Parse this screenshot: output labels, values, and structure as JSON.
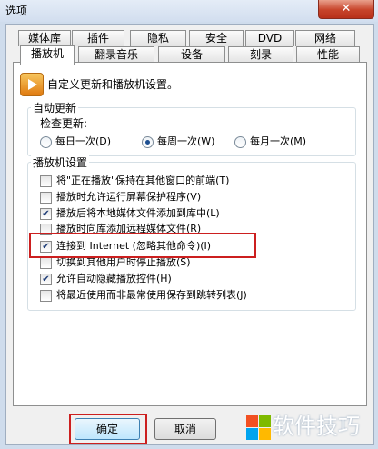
{
  "window": {
    "title": "选项",
    "close_glyph": "✕"
  },
  "tabs": {
    "back_row": [
      "媒体库",
      "插件",
      "隐私",
      "安全",
      "DVD",
      "网络"
    ],
    "front_row": [
      "播放机",
      "翻录音乐",
      "设备",
      "刻录",
      "性能"
    ],
    "active": "播放机"
  },
  "header": {
    "icon": "player-icon",
    "description": "自定义更新和播放机设置。"
  },
  "auto_update": {
    "title": "自动更新",
    "check_label": "检查更新:",
    "options": [
      {
        "label": "每日一次(D)",
        "selected": false
      },
      {
        "label": "每周一次(W)",
        "selected": true
      },
      {
        "label": "每月一次(M)",
        "selected": false
      }
    ]
  },
  "player_settings": {
    "title": "播放机设置",
    "options": [
      {
        "label": "将\"正在播放\"保持在其他窗口的前端(T)",
        "checked": false
      },
      {
        "label": "播放时允许运行屏幕保护程序(V)",
        "checked": false
      },
      {
        "label": "播放后将本地媒体文件添加到库中(L)",
        "checked": true
      },
      {
        "label": "播放时向库添加远程媒体文件(R)",
        "checked": false
      },
      {
        "label": "连接到 Internet (忽略其他命令)(I)",
        "checked": true
      },
      {
        "label": "切换到其他用户时停止播放(S)",
        "checked": false
      },
      {
        "label": "允许自动隐藏播放控件(H)",
        "checked": true
      },
      {
        "label": "将最近使用而非最常使用保存到跳转列表(J)",
        "checked": false
      }
    ]
  },
  "buttons": {
    "ok": "确定",
    "cancel": "取消"
  },
  "watermark": {
    "text": "软件技巧",
    "colors": [
      "#f25022",
      "#7fba00",
      "#00a4ef",
      "#ffb900"
    ]
  }
}
